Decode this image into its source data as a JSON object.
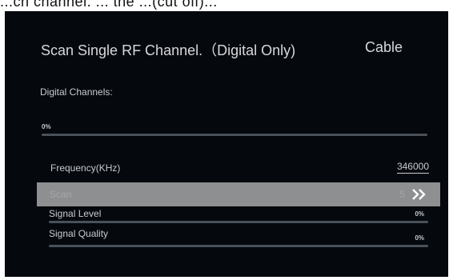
{
  "top_strip_text": "...ch channel. ... the ...(cut off)...",
  "header": {
    "title": "Scan Single RF Channel.（Digital Only)",
    "mode": "Cable"
  },
  "digital_channels": {
    "label": "Digital Channels:",
    "progress_text": "0%",
    "progress": 0
  },
  "frequency": {
    "label": "Frequency(KHz)",
    "value": "346000"
  },
  "scan": {
    "label": "Scan",
    "value": "5",
    "icon": "double-chevron-right-icon"
  },
  "signal_level": {
    "label": "Signal Level",
    "percent_text": "0%",
    "level": 0
  },
  "signal_quality": {
    "label": "Signal Quality",
    "percent_text": "0%",
    "level": 0
  }
}
